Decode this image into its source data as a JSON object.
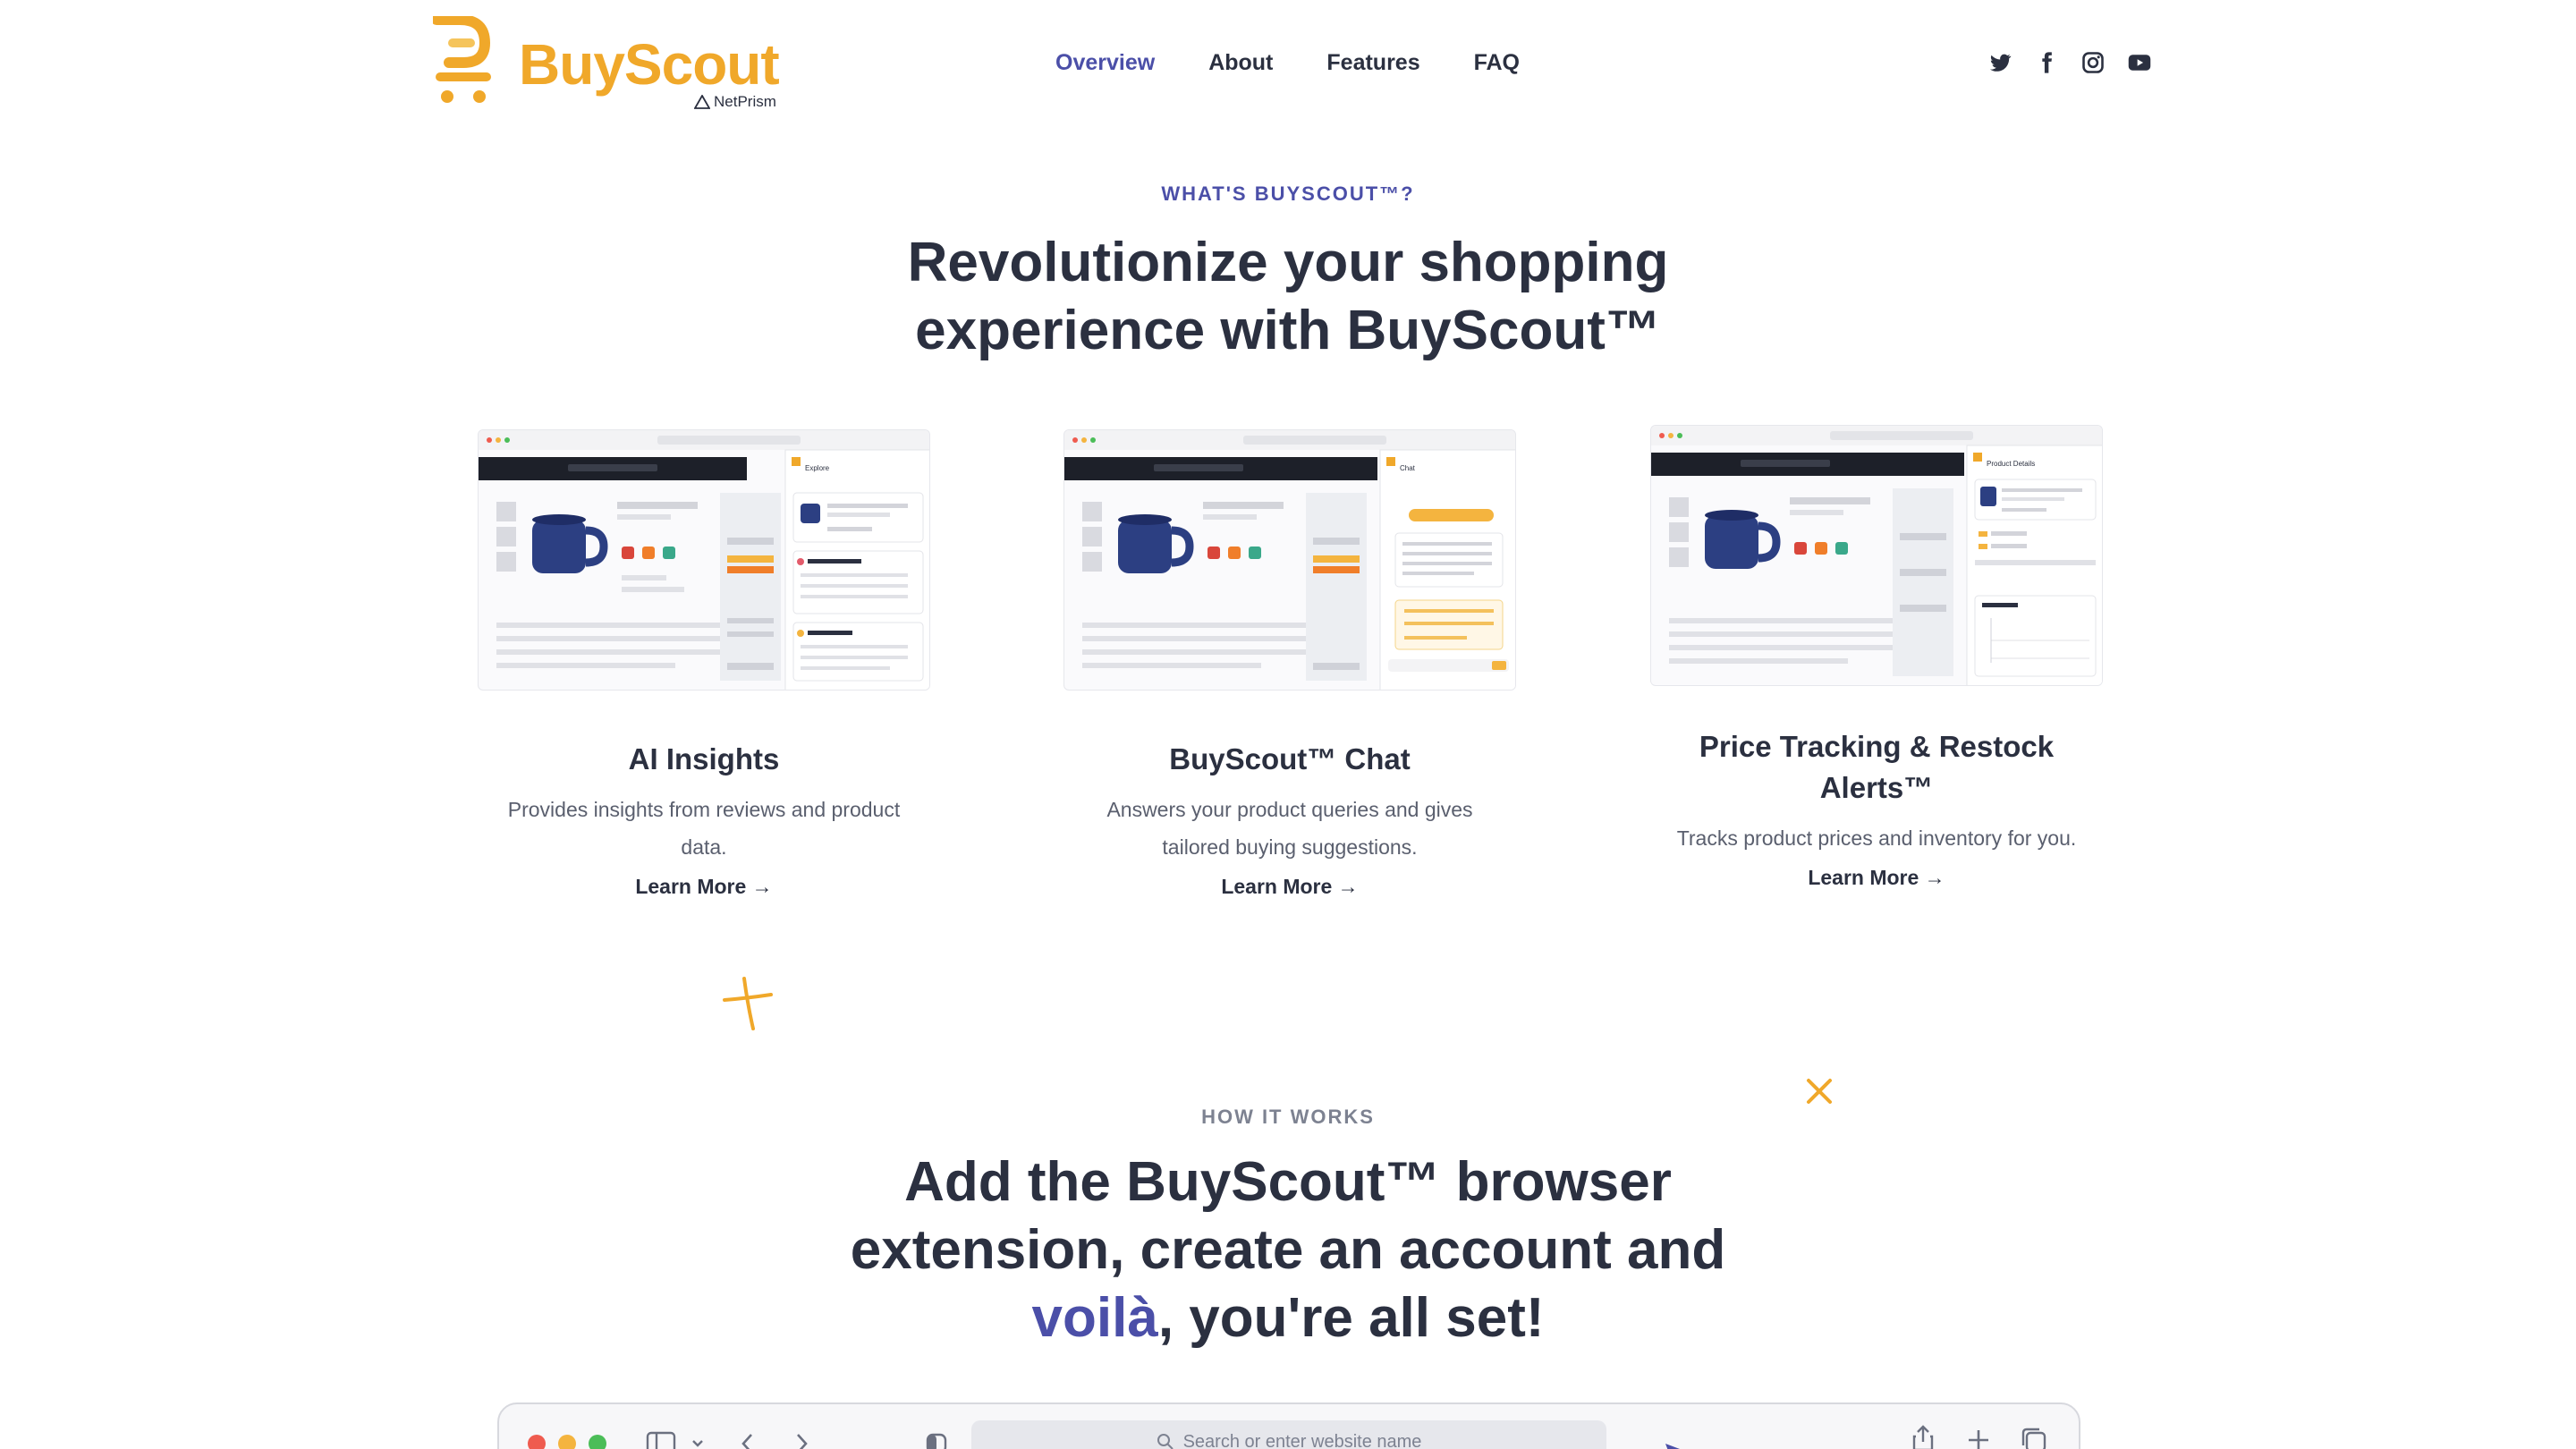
{
  "header": {
    "logo_text": "BuyScout",
    "logo_sub": "NetPrism",
    "nav": [
      {
        "label": "Overview",
        "active": true
      },
      {
        "label": "About",
        "active": false
      },
      {
        "label": "Features",
        "active": false
      },
      {
        "label": "FAQ",
        "active": false
      }
    ],
    "social": [
      "twitter-icon",
      "facebook-icon",
      "instagram-icon",
      "youtube-icon"
    ]
  },
  "intro": {
    "eyebrow": "WHAT'S BUYSCOUT™?",
    "headline_line1": "Revolutionize your shopping",
    "headline_line2": "experience with BuyScout™"
  },
  "features": [
    {
      "title": "AI Insights",
      "desc": "Provides insights from reviews and product data.",
      "link": "Learn More →",
      "panel_title": "Explore"
    },
    {
      "title": "BuyScout™ Chat",
      "desc": "Answers your product queries and gives tailored buying suggestions.",
      "link": "Learn More →",
      "panel_title": "Chat"
    },
    {
      "title": "Price Tracking & Restock Alerts™",
      "desc": "Tracks product prices and inventory for you.",
      "link": "Learn More →",
      "panel_title": "Product Details"
    }
  ],
  "how": {
    "eyebrow": "HOW IT WORKS",
    "line1": "Add the BuyScout™ browser",
    "line2": "extension, create an account and",
    "accent": "voilà",
    "line3_rest": ", you're all set!"
  },
  "browser": {
    "search_placeholder": "Search or enter website name"
  },
  "colors": {
    "brand": "#f0a82a",
    "accent": "#4b4fa8",
    "text": "#2b3040"
  }
}
